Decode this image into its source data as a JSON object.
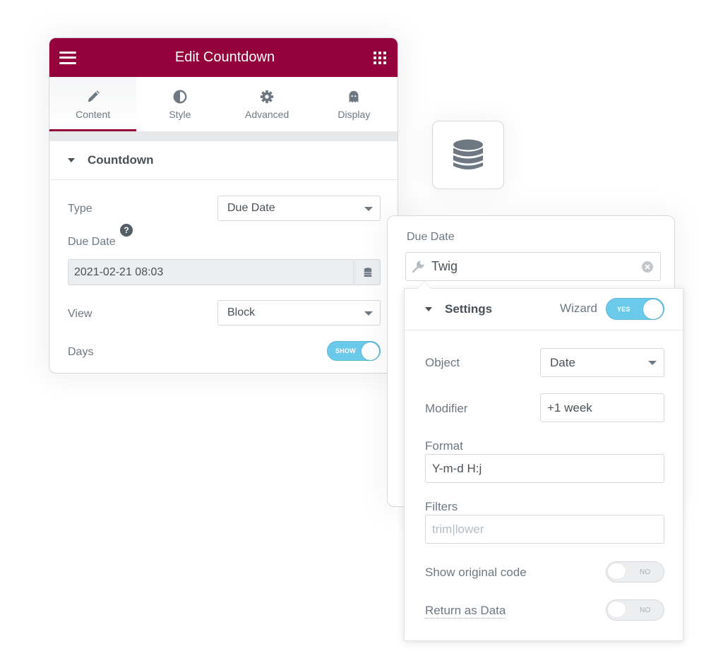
{
  "panel": {
    "title": "Edit Countdown",
    "menu_icon": "hamburger-icon",
    "widgets_icon": "apps-grid-icon",
    "tabs": [
      {
        "label": "Content",
        "icon": "pencil-icon",
        "active": true
      },
      {
        "label": "Style",
        "icon": "half-circle-icon",
        "active": false
      },
      {
        "label": "Advanced",
        "icon": "gear-icon",
        "active": false
      },
      {
        "label": "Display",
        "icon": "ghost-icon",
        "active": false
      }
    ],
    "section_title": "Countdown",
    "controls": {
      "type": {
        "label": "Type",
        "value": "Due Date"
      },
      "due_date": {
        "label": "Due Date",
        "help": "?",
        "value": "2021-02-21 08:03"
      },
      "view": {
        "label": "View",
        "value": "Block"
      },
      "days": {
        "label": "Days",
        "toggle": "SHOW",
        "on": true
      }
    }
  },
  "db_card": {
    "icon": "database-icon"
  },
  "tag_panel": {
    "label": "Due Date",
    "tag_icon": "wrench-icon",
    "tag_name": "Twig",
    "clear_icon": "clear-circle-icon"
  },
  "settings": {
    "title": "Settings",
    "wizard": {
      "label": "Wizard",
      "toggle": "YES",
      "on": true
    },
    "object": {
      "label": "Object",
      "value": "Date"
    },
    "modifier": {
      "label": "Modifier",
      "value": "+1 week"
    },
    "format": {
      "label": "Format",
      "value": "Y-m-d H:j"
    },
    "filters": {
      "label": "Filters",
      "placeholder": "trim|lower"
    },
    "show_original_code": {
      "label": "Show original code",
      "toggle": "NO",
      "on": false
    },
    "return_as_data": {
      "label": "Return as Data",
      "toggle": "NO",
      "on": false
    }
  },
  "colors": {
    "brand": "#93003c",
    "toggle_on": "#6bc9ea",
    "text": "#6d7882",
    "text_dark": "#495157"
  }
}
